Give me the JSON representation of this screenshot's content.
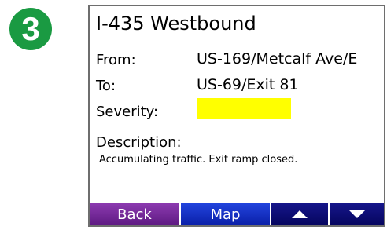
{
  "step_number": "3",
  "traffic_info": {
    "road": "I-435 Westbound",
    "from_label": "From:",
    "from_value": "US-169/Metcalf Ave/E",
    "to_label": "To:",
    "to_value": "US-69/Exit 81",
    "severity_label": "Severity:",
    "severity_color": "#ffff00",
    "description_label": "Description:",
    "description_text": "Accumulating traffic. Exit ramp closed."
  },
  "buttons": {
    "back_label": "Back",
    "map_label": "Map",
    "up_icon": "arrow-up-icon",
    "down_icon": "arrow-down-icon"
  }
}
